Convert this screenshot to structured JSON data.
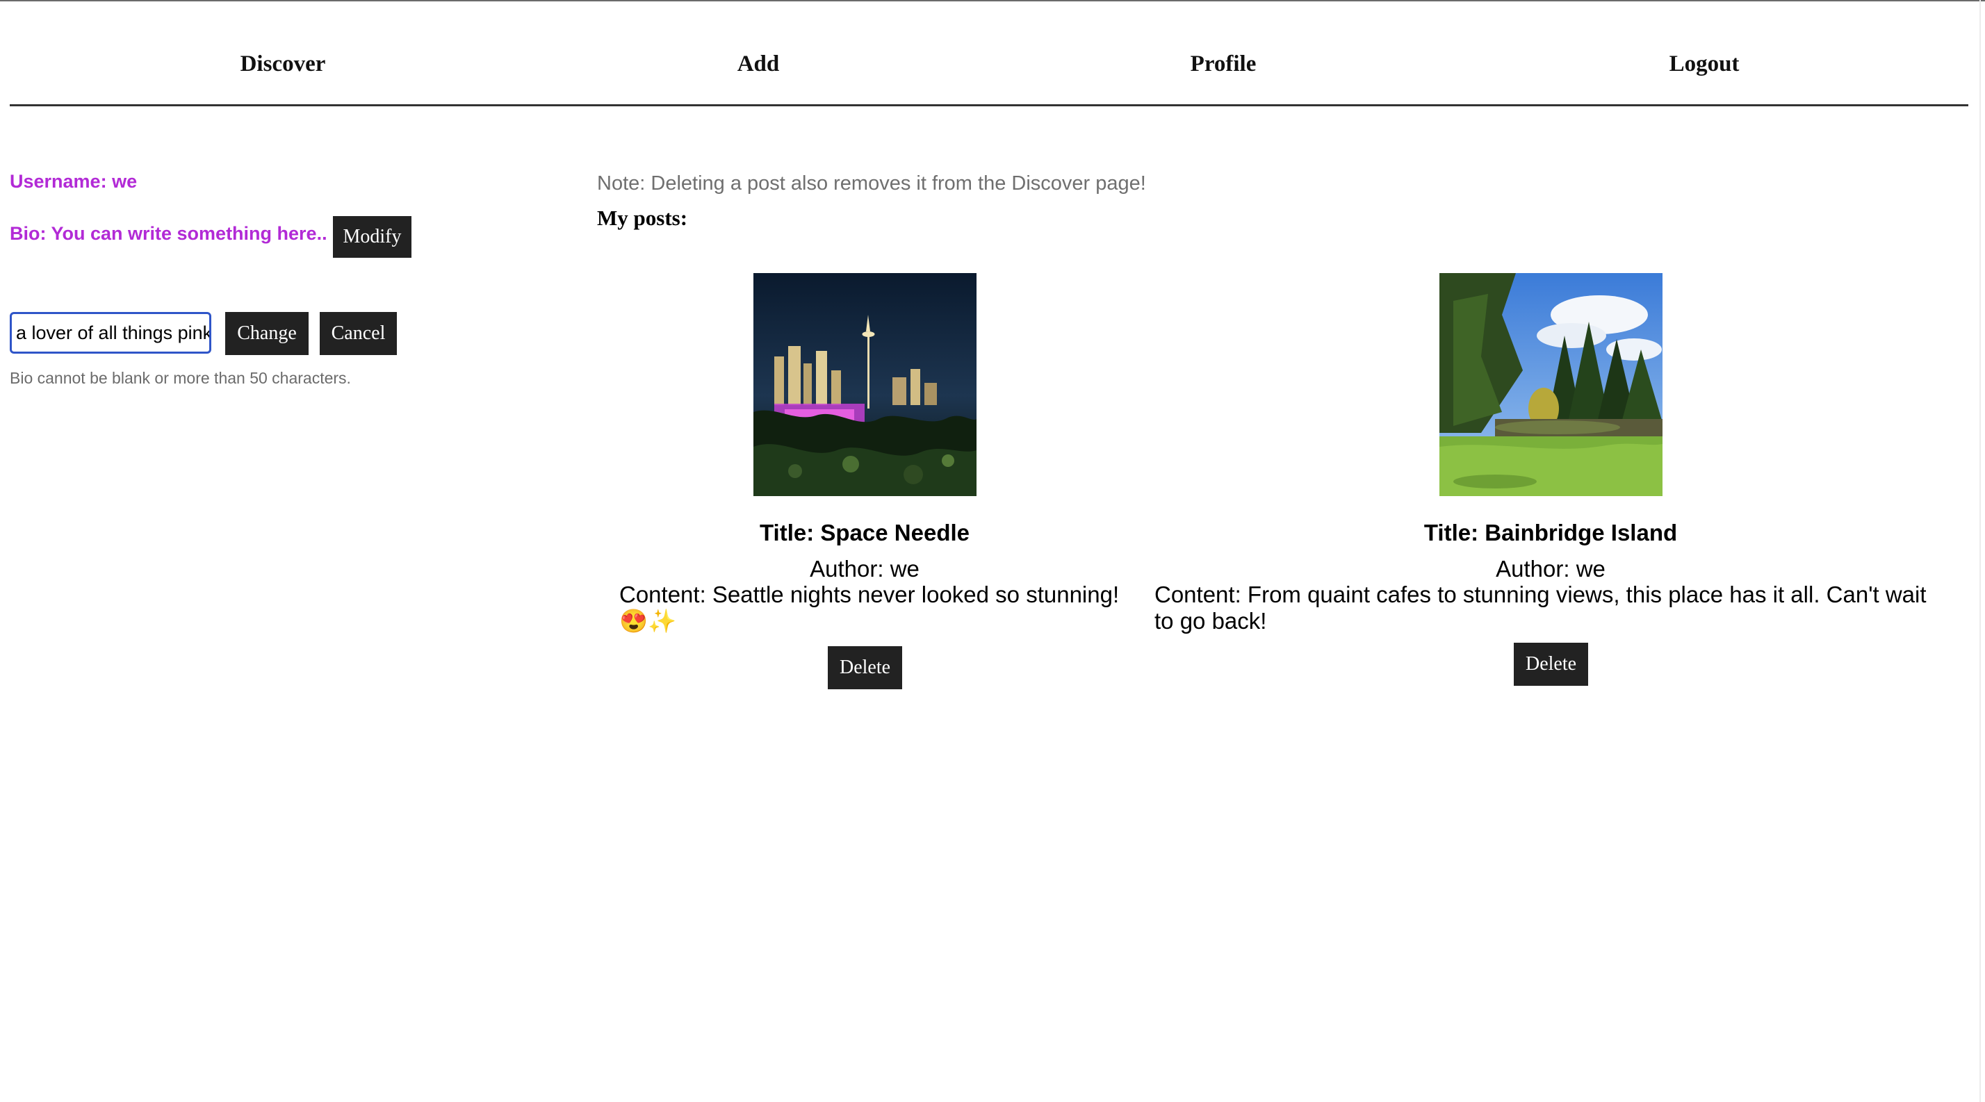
{
  "nav": {
    "discover": "Discover",
    "add": "Add",
    "profile": "Profile",
    "logout": "Logout"
  },
  "profile": {
    "username": "Username: we",
    "bio": "Bio: You can write something here..",
    "modify_label": "Modify",
    "bio_input_value": "a lover of all things pink!",
    "change_label": "Change",
    "cancel_label": "Cancel",
    "hint": "Bio cannot be blank or more than 50 characters.",
    "accent_color": "#b22ad6"
  },
  "main": {
    "note": "Note: Deleting a post also removes it from the Discover page!",
    "posts_heading": "My posts:",
    "posts": [
      {
        "title": "Title: Space Needle",
        "author": "Author: we",
        "content": "Content: Seattle nights never looked so stunning! 😍✨",
        "delete_label": "Delete",
        "image": "seattle-night-skyline-photo"
      },
      {
        "title": "Title: Bainbridge Island",
        "author": "Author: we",
        "content": "Content: From quaint cafes to stunning views, this place has it all. Can't wait to go back!",
        "delete_label": "Delete",
        "image": "park-pond-trees-photo"
      }
    ]
  }
}
